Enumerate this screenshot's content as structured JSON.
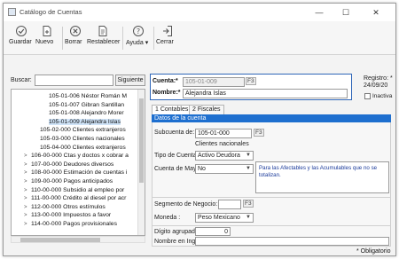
{
  "window": {
    "title": "Catálogo de Cuentas",
    "minimize_glyph": "—",
    "maximize_glyph": "☐",
    "close_glyph": "✕"
  },
  "toolbar": {
    "items": [
      {
        "label": "Guardar",
        "icon": "save-check-icon"
      },
      {
        "label": "Nuevo",
        "icon": "new-document-icon"
      },
      {
        "label": "Borrar",
        "icon": "delete-icon"
      },
      {
        "label": "Restablecer",
        "icon": "reset-icon"
      },
      {
        "label": "Ayuda",
        "icon": "help-icon",
        "dropdown": "▾"
      },
      {
        "label": "Cerrar",
        "icon": "close-door-icon"
      }
    ]
  },
  "search": {
    "label": "Buscar:",
    "value": "",
    "button_label": "Siguiente"
  },
  "tree": {
    "rows": [
      {
        "text": "105-01-006 Néstor Román M",
        "indent": 3,
        "arrow": "",
        "selected": false
      },
      {
        "text": "105-01-007 Gibran Santillan",
        "indent": 3,
        "arrow": "",
        "selected": false
      },
      {
        "text": "105-01-008 Alejandro Morer",
        "indent": 3,
        "arrow": "",
        "selected": false
      },
      {
        "text": "105-01-009 Alejandra Islas",
        "indent": 3,
        "arrow": "",
        "selected": true
      },
      {
        "text": "105-02-000 Clientes extranjeros",
        "indent": 2,
        "arrow": "",
        "selected": false
      },
      {
        "text": "105-03-000 Clientes nacionales",
        "indent": 2,
        "arrow": "",
        "selected": false
      },
      {
        "text": "105-04-000 Clientes extranjeros",
        "indent": 2,
        "arrow": "",
        "selected": false
      },
      {
        "text": "106-00-000 Ctas y doctos x cobrar a",
        "indent": 1,
        "arrow": ">",
        "selected": false
      },
      {
        "text": "107-00-000 Deudores diversos",
        "indent": 1,
        "arrow": ">",
        "selected": false
      },
      {
        "text": "108-00-000 Estimación de cuentas i",
        "indent": 1,
        "arrow": ">",
        "selected": false
      },
      {
        "text": "109-00-000 Pagos anticipados",
        "indent": 1,
        "arrow": ">",
        "selected": false
      },
      {
        "text": "110-00-000 Subsidio al empleo por",
        "indent": 1,
        "arrow": ">",
        "selected": false
      },
      {
        "text": "111-00-000 Crédito al diesel por acr",
        "indent": 1,
        "arrow": ">",
        "selected": false
      },
      {
        "text": "112-00-000 Otros estímulos",
        "indent": 1,
        "arrow": ">",
        "selected": false
      },
      {
        "text": "113-00-000 Impuestos a favor",
        "indent": 1,
        "arrow": ">",
        "selected": false
      },
      {
        "text": "114-00-000 Pagos provisionales",
        "indent": 1,
        "arrow": ">",
        "selected": false
      }
    ]
  },
  "form": {
    "cuenta_label": "Cuenta:*",
    "cuenta_value": "105-01-009",
    "f3": "F3",
    "nombre_label": "Nombre:*",
    "nombre_value": "Alejandra Islas",
    "registro_label": "Registro: *",
    "registro_value": "24/09/20",
    "inactiva_label": "Inactiva"
  },
  "tabs": [
    {
      "label": "1 Contables",
      "active": true
    },
    {
      "label": "2 Fiscales",
      "active": false
    }
  ],
  "section": {
    "title": "Datos de la cuenta",
    "subcuenta_label": "Subcuenta de:",
    "subcuenta_value": "105-01-000",
    "subcuenta_desc": "Clientes nacionales",
    "tipo_label": "Tipo de Cuenta:",
    "tipo_value": "Activo Deudora",
    "mayor_label": "Cuenta de Mayor:",
    "mayor_value": "No",
    "note": "Para las Afectables y las Acumulables que no se totalizan.",
    "segmento_label": "Segmento de Negocio:",
    "segmento_value": "",
    "moneda_label": "Moneda :",
    "moneda_value": "Peso Mexicano",
    "digito_label": "Dígito agrupador:",
    "digito_value": "0",
    "ingles_label": "Nombre en Inglés:",
    "ingles_value": ""
  },
  "footer": {
    "required_note": "* Obligatorio"
  },
  "colors": {
    "accent": "#1e6fcf",
    "form_border": "#2f66b8",
    "selection": "#cfe3f7"
  }
}
